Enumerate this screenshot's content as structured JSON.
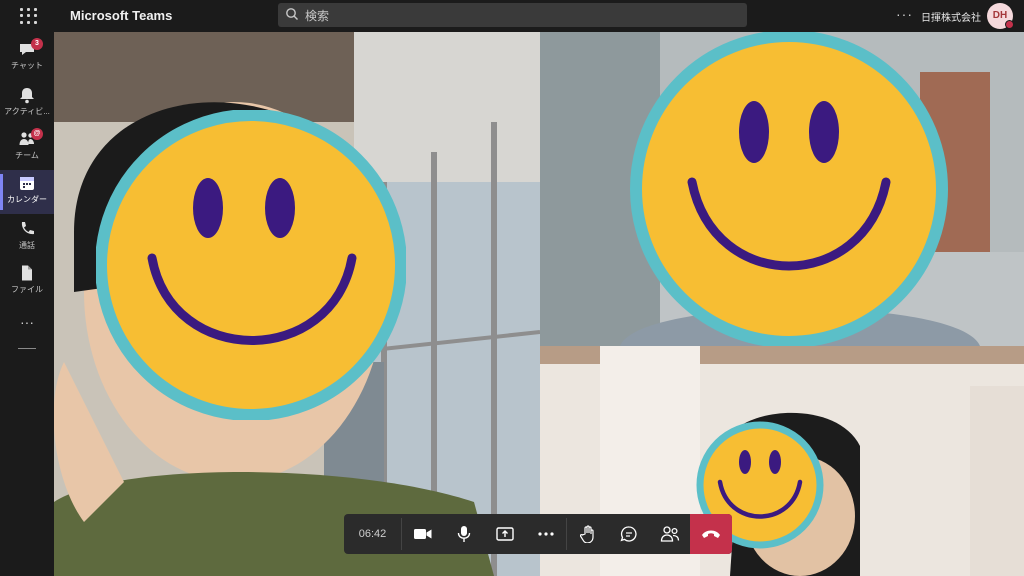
{
  "app": {
    "title": "Microsoft Teams",
    "search_placeholder": "検索",
    "org_name": "日揮株式会社",
    "avatar_initials": "DH",
    "more_label": "···"
  },
  "sidebar": {
    "items": [
      {
        "label": "チャット",
        "icon": "chat-icon",
        "badge": "3"
      },
      {
        "label": "アクティビ...",
        "icon": "bell-icon",
        "badge": ""
      },
      {
        "label": "チーム",
        "icon": "teams-icon",
        "badge": "@"
      },
      {
        "label": "カレンダー",
        "icon": "calendar-icon",
        "badge": "",
        "active": true
      },
      {
        "label": "通話",
        "icon": "phone-icon",
        "badge": ""
      },
      {
        "label": "ファイル",
        "icon": "file-icon",
        "badge": ""
      }
    ],
    "more_label": "···"
  },
  "call": {
    "timer": "06:42",
    "controls": [
      "camera-icon",
      "microphone-icon",
      "share-screen-icon",
      "more-icon",
      "raise-hand-icon",
      "chat-icon",
      "participants-icon",
      "hang-up-icon"
    ]
  },
  "colors": {
    "accent": "#7f85f5",
    "badge": "#c4314b",
    "hangup": "#c4314b",
    "smiley_face": "#f7be33",
    "smiley_ring": "#5bbfc8",
    "smiley_features": "#3b1a80"
  }
}
